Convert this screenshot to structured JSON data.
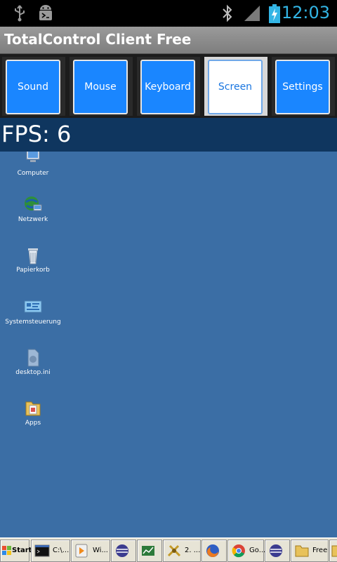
{
  "status_bar": {
    "time": "12:03",
    "icons": [
      "usb-icon",
      "android-debug-icon",
      "bluetooth-icon",
      "signal-icon",
      "battery-charging-icon"
    ],
    "time_color": "#33b5e5"
  },
  "app": {
    "title": "TotalControl Client Free"
  },
  "tabs": [
    {
      "label": "Sound",
      "active": false
    },
    {
      "label": "Mouse",
      "active": false
    },
    {
      "label": "Keyboard",
      "active": false
    },
    {
      "label": "Screen",
      "active": true
    },
    {
      "label": "Settings",
      "active": false
    }
  ],
  "overlay": {
    "fps": "FPS: 6"
  },
  "desktop": {
    "background": "#3b6ea5",
    "icons": [
      {
        "label": "Computer",
        "icon": "computer-icon"
      },
      {
        "label": "Netzwerk",
        "icon": "network-icon"
      },
      {
        "label": "Papierkorb",
        "icon": "recycle-bin-icon"
      },
      {
        "label": "Systemsteuerung",
        "icon": "control-panel-icon"
      },
      {
        "label": "desktop.ini",
        "icon": "ini-file-icon"
      },
      {
        "label": "Apps",
        "icon": "folder-icon"
      }
    ]
  },
  "taskbar": {
    "start": "Start",
    "items": [
      {
        "label": "C:\\...",
        "icon": "cmd-icon"
      },
      {
        "label": "Wi...",
        "icon": "media-player-icon"
      },
      {
        "label": "",
        "icon": "eclipse-icon"
      },
      {
        "label": "",
        "icon": "chart-app-icon"
      },
      {
        "label": "2. ...",
        "icon": "tools-icon"
      },
      {
        "label": "",
        "icon": "firefox-icon"
      },
      {
        "label": "Go...",
        "icon": "chrome-icon"
      },
      {
        "label": "",
        "icon": "eclipse-icon"
      },
      {
        "label": "Free",
        "icon": "folder-icon"
      },
      {
        "label": "",
        "icon": "folder-icon"
      }
    ]
  }
}
